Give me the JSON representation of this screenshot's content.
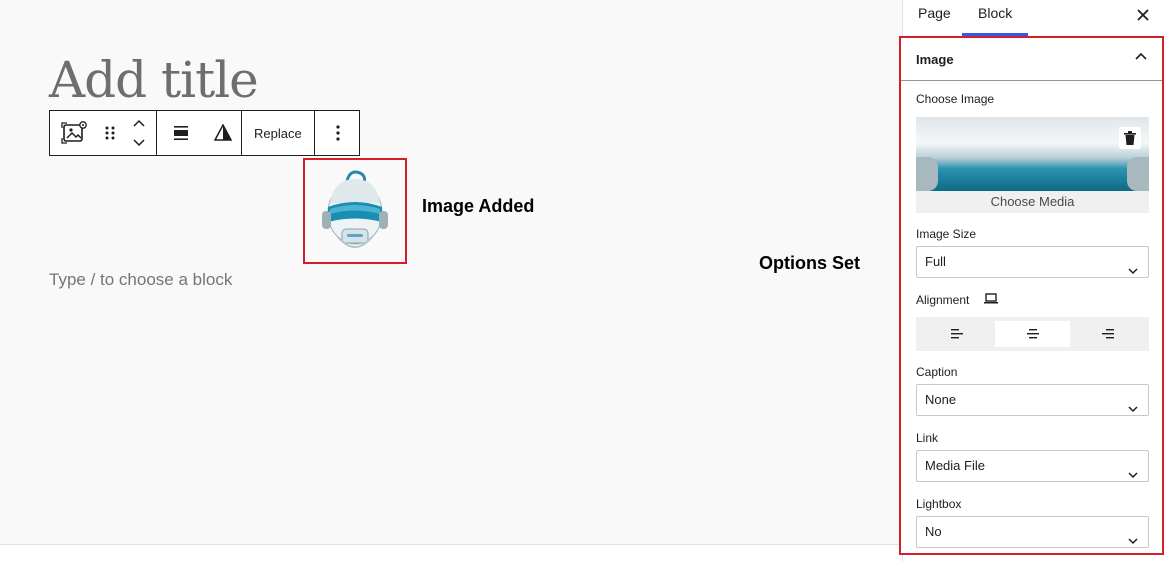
{
  "editor": {
    "title_placeholder": "Add title",
    "block_appender": "Type / to choose a block",
    "toolbar": {
      "replace_label": "Replace"
    },
    "annotations": {
      "image_added": "Image Added",
      "options_set": "Options Set"
    }
  },
  "sidebar": {
    "tabs": [
      {
        "label": "Page"
      },
      {
        "label": "Block"
      }
    ],
    "active_tab": "Block",
    "panel": {
      "title": "Image",
      "choose_image_label": "Choose Image",
      "choose_media_label": "Choose Media",
      "image_size_label": "Image Size",
      "image_size_value": "Full",
      "alignment_label": "Alignment",
      "alignment_options": [
        "left",
        "center",
        "right"
      ],
      "alignment_selected": "center",
      "caption_label": "Caption",
      "caption_value": "None",
      "link_label": "Link",
      "link_value": "Media File",
      "lightbox_label": "Lightbox",
      "lightbox_value": "No"
    }
  },
  "colors": {
    "highlight_border": "#d21f2a",
    "accent": "#3858e9",
    "canvas_bg": "#f9f9f9"
  }
}
